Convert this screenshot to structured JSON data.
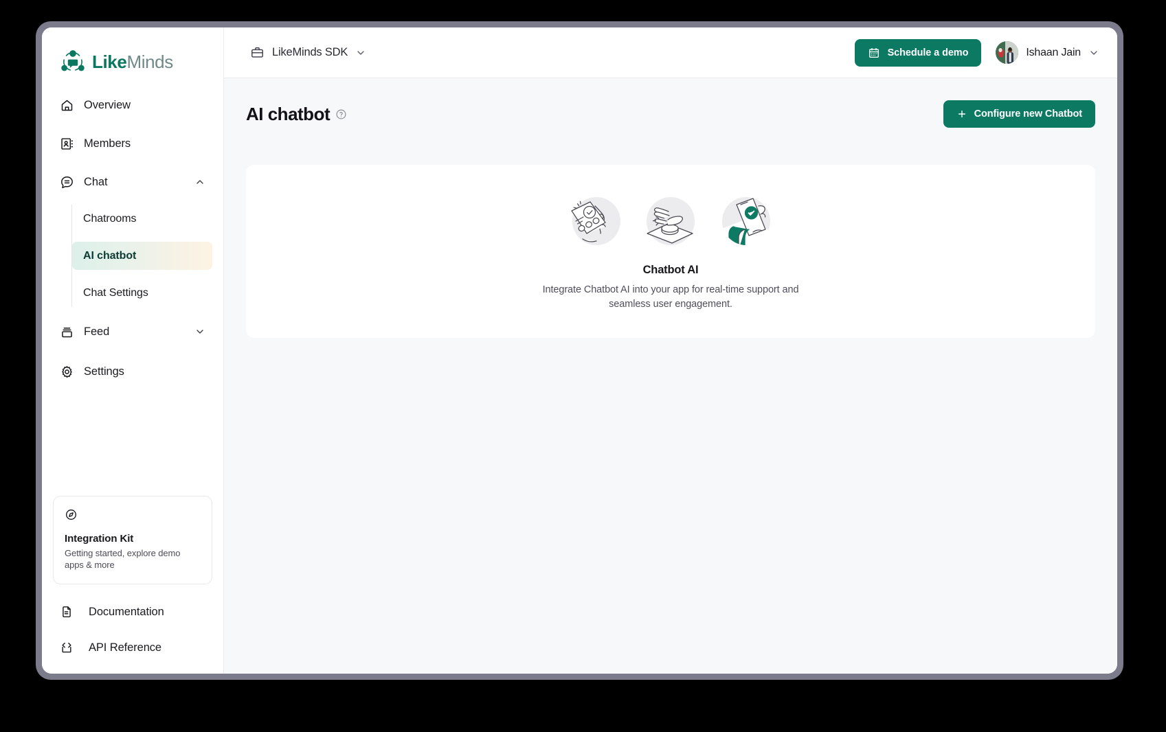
{
  "brand": {
    "part1": "Like",
    "part2": "Minds"
  },
  "topbar": {
    "workspace": "LikeMinds SDK",
    "schedule_demo_label": "Schedule a demo",
    "user_name": "Ishaan Jain"
  },
  "sidebar": {
    "items": [
      {
        "label": "Overview",
        "icon": "home-icon"
      },
      {
        "label": "Members",
        "icon": "contact-book-icon"
      },
      {
        "label": "Chat",
        "icon": "chat-bubble-icon",
        "expanded": true
      }
    ],
    "chat_children": [
      {
        "label": "Chatrooms",
        "active": false
      },
      {
        "label": "AI chatbot",
        "active": true
      },
      {
        "label": "Chat Settings",
        "active": false
      }
    ],
    "feed": {
      "label": "Feed",
      "icon": "feed-icon",
      "expanded": false
    },
    "settings": {
      "label": "Settings",
      "icon": "gear-icon"
    },
    "integration_kit": {
      "icon": "compass-icon",
      "title": "Integration Kit",
      "subtitle": "Getting started, explore demo apps & more"
    },
    "bottom_items": [
      {
        "label": "Documentation",
        "icon": "document-icon"
      },
      {
        "label": "API Reference",
        "icon": "code-brackets-icon"
      }
    ]
  },
  "page": {
    "title": "AI chatbot",
    "help_icon": "question-circle-icon",
    "configure_button": "Configure new Chatbot",
    "plus_icon": "plus-icon"
  },
  "empty_state": {
    "title": "Chatbot AI",
    "description": "Integrate Chatbot AI into your app for real-time support and seamless user engagement.",
    "illustrations": [
      "hand-holding-card-illustration",
      "hand-pressing-button-illustration",
      "hand-holding-phone-illustration"
    ]
  },
  "colors": {
    "accent": "#0c7a63",
    "brand_dark": "#0a7861",
    "brand_light": "#6f8a88",
    "page_bg": "#f7f8fa",
    "frame": "#7b7b8c"
  }
}
